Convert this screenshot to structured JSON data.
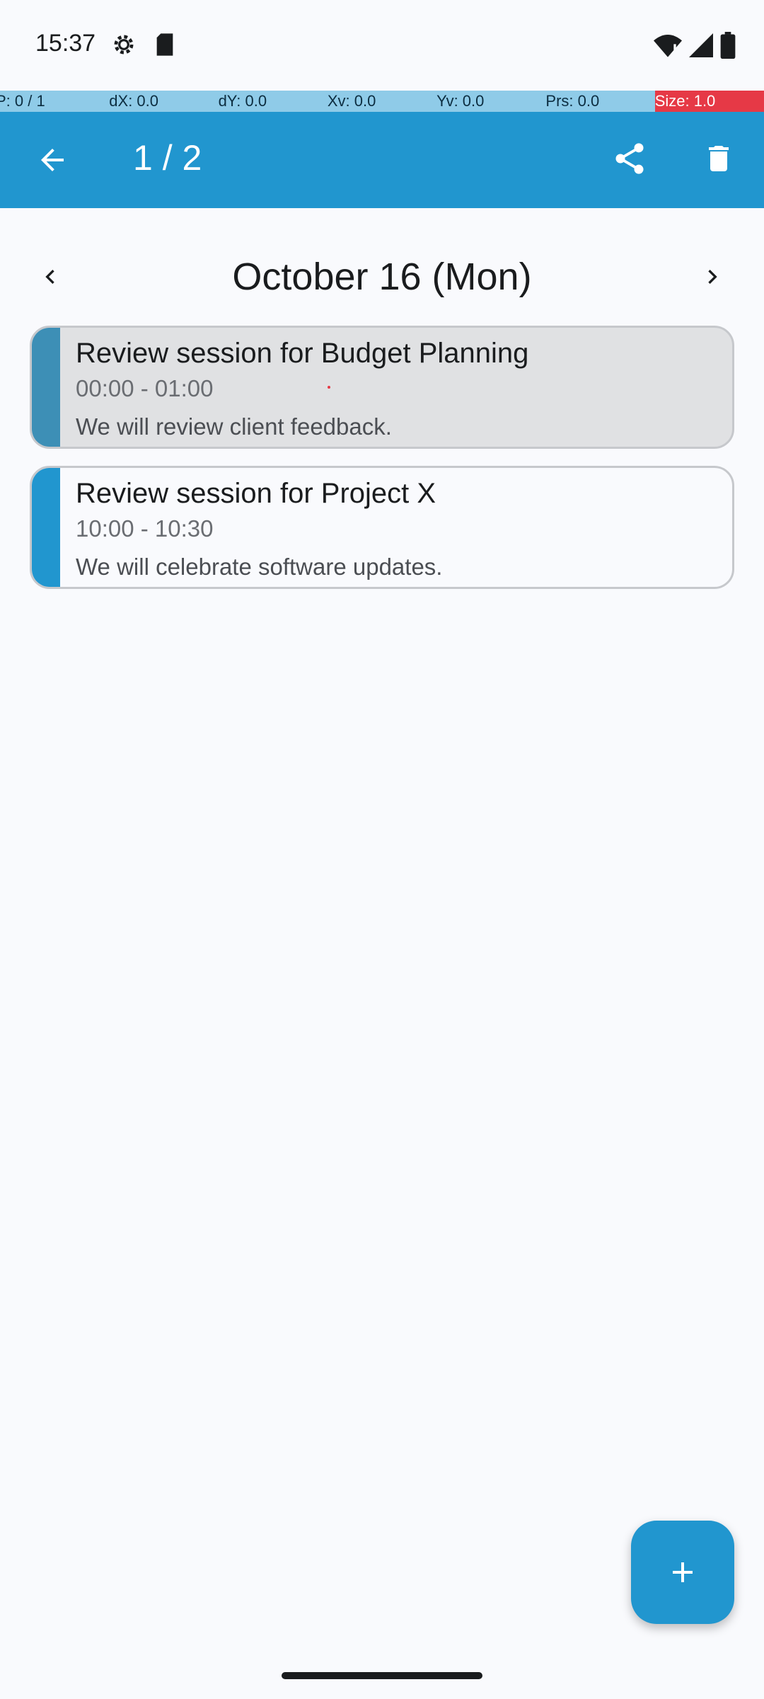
{
  "status_bar": {
    "time": "15:37",
    "icons": [
      "settings-gear-icon",
      "sd-card-icon",
      "wifi-alert-icon",
      "cell-signal-icon",
      "battery-icon"
    ]
  },
  "pointer_overlay": {
    "cells": [
      "P: 0 / 1",
      "dX: 0.0",
      "dY: 0.0",
      "Xv: 0.0",
      "Yv: 0.0",
      "Prs: 0.0",
      "Size: 1.0"
    ]
  },
  "toolbar": {
    "title": "1 / 2",
    "back_icon": "arrow-back-icon",
    "share_icon": "share-icon",
    "delete_icon": "trash-icon"
  },
  "date_nav": {
    "title": "October 16 (Mon)",
    "prev_icon": "chevron-left-icon",
    "next_icon": "chevron-right-icon"
  },
  "events": [
    {
      "title": "Review session for Budget Planning",
      "time": "00:00 - 01:00",
      "description": "We will review client feedback."
    },
    {
      "title": "Review session for Project X",
      "time": "10:00 - 10:30",
      "description": "We will celebrate software updates."
    }
  ],
  "fab": {
    "icon": "plus-icon"
  },
  "colors": {
    "primary": "#2196cf",
    "event_1_stripe": "#3d8fb6",
    "event_1_background": "#e0e1e3",
    "overlay_blue": "#8fcbe8",
    "overlay_red": "#e63946"
  }
}
